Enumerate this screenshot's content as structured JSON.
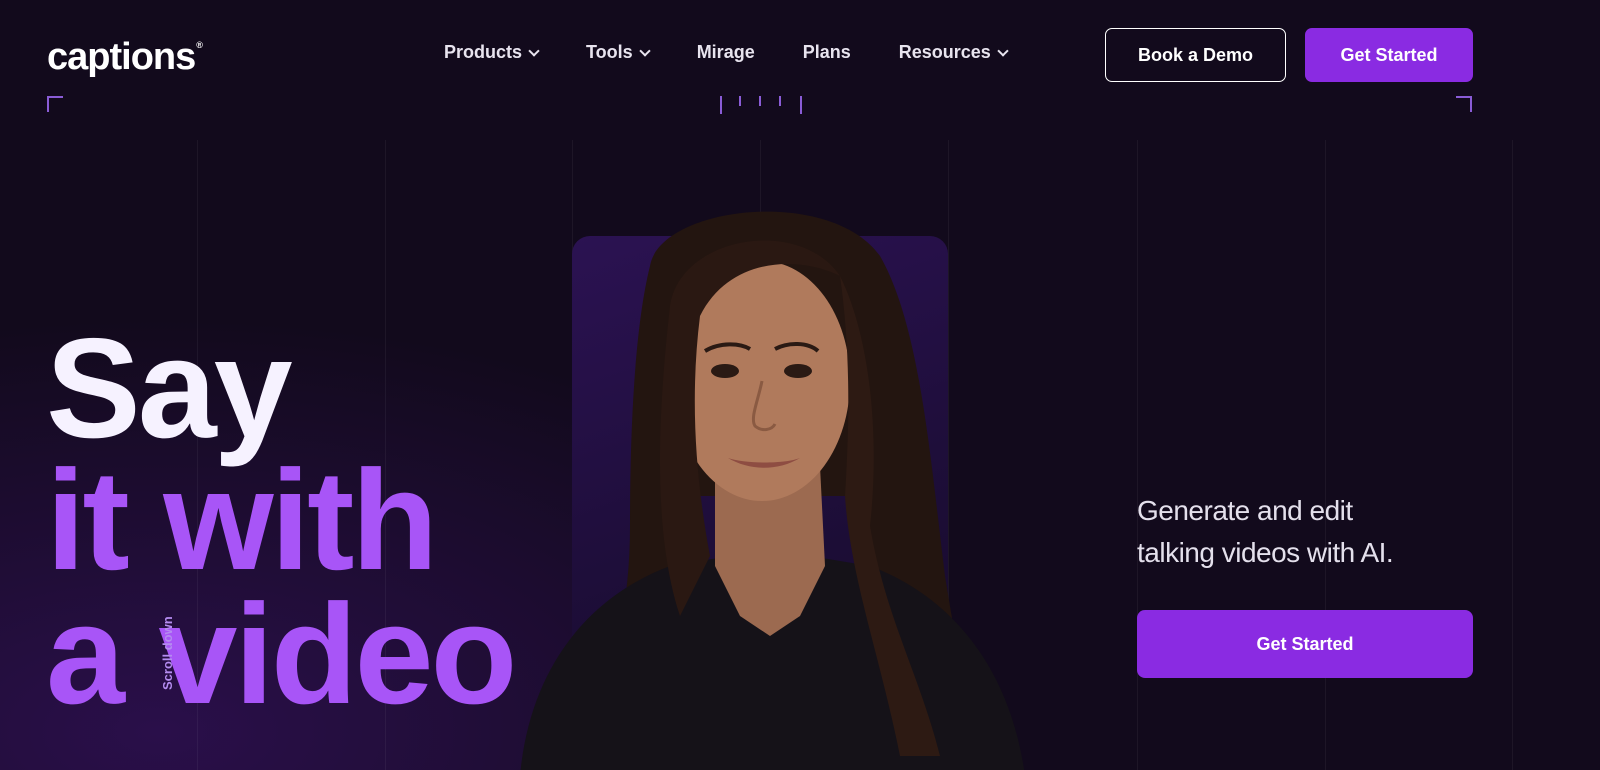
{
  "header": {
    "logo_text": "captions",
    "logo_mark": "®",
    "nav": [
      {
        "label": "Products",
        "has_dropdown": true
      },
      {
        "label": "Tools",
        "has_dropdown": true
      },
      {
        "label": "Mirage",
        "has_dropdown": false
      },
      {
        "label": "Plans",
        "has_dropdown": false
      },
      {
        "label": "Resources",
        "has_dropdown": true
      }
    ],
    "book_demo_label": "Book a Demo",
    "get_started_label": "Get Started"
  },
  "hero": {
    "line1": "Say",
    "line2": "it with",
    "line3": "a video",
    "scroll_label": "Scroll down",
    "tagline": "Generate and edit talking videos with AI.",
    "cta_label": "Get Started"
  },
  "colors": {
    "background": "#120a1c",
    "accent": "#8a2be2",
    "headline_white": "#f6f2ff",
    "headline_purple": "#a855f7"
  }
}
